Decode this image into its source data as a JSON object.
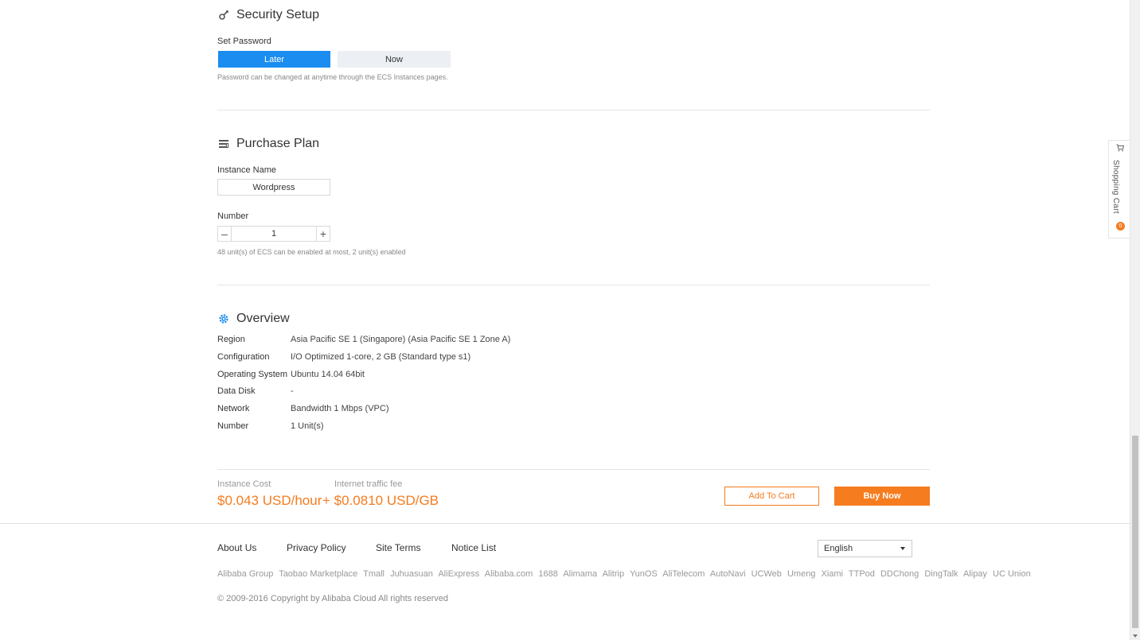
{
  "security": {
    "title": "Security Setup",
    "set_password_label": "Set Password",
    "options": [
      "Later",
      "Now"
    ],
    "selected": "Later",
    "hint": "Password can be changed at anytime through the ECS Instances pages."
  },
  "purchase": {
    "title": "Purchase Plan",
    "instance_name_label": "Instance Name",
    "instance_name_value": "Wordpress",
    "number_label": "Number",
    "number_value": "1",
    "minus_symbol": "–",
    "plus_symbol": "+",
    "hint": "48 unit(s) of ECS can be enabled at most, 2 unit(s) enabled"
  },
  "overview": {
    "title": "Overview",
    "rows": [
      {
        "key": "Region",
        "value": "Asia Pacific SE 1 (Singapore) (Asia Pacific SE 1 Zone A)"
      },
      {
        "key": "Configuration",
        "value": "I/O Optimized 1-core, 2 GB (Standard type s1)"
      },
      {
        "key": "Operating System",
        "value": "Ubuntu 14.04 64bit"
      },
      {
        "key": "Data Disk",
        "value": "-"
      },
      {
        "key": "Network",
        "value": "Bandwidth 1 Mbps (VPC)"
      },
      {
        "key": "Number",
        "value": "1 Unit(s)"
      }
    ]
  },
  "cost": {
    "instance_label": "Instance Cost",
    "instance_value": "$0.043 USD/hour",
    "traffic_label": "Internet traffic fee",
    "traffic_value": "+ $0.0810 USD/GB",
    "add_to_cart": "Add To Cart",
    "buy_now": "Buy Now"
  },
  "footer": {
    "links": [
      "About Us",
      "Privacy Policy",
      "Site Terms",
      "Notice List"
    ],
    "language": "English",
    "partners": [
      "Alibaba Group",
      "Taobao Marketplace",
      "Tmall",
      "Juhuasuan",
      "AliExpress",
      "Alibaba.com",
      "1688",
      "Alimama",
      "Alitrip",
      "YunOS",
      "AliTelecom",
      "AutoNavi",
      "UCWeb",
      "Umeng",
      "Xiami",
      "TTPod",
      "DDChong",
      "DingTalk",
      "Alipay",
      "UC Union"
    ],
    "copyright": "© 2009-2016 Copyright by Alibaba Cloud All rights reserved"
  },
  "cart_tab": {
    "label": "Shopping Cart",
    "count": "0"
  },
  "colors": {
    "primary_blue": "#1b8cf0",
    "accent_orange": "#f57c1f"
  },
  "icons": {
    "security": "key-icon",
    "purchase": "list-icon",
    "overview": "gear-icon",
    "cart": "cart-icon"
  }
}
